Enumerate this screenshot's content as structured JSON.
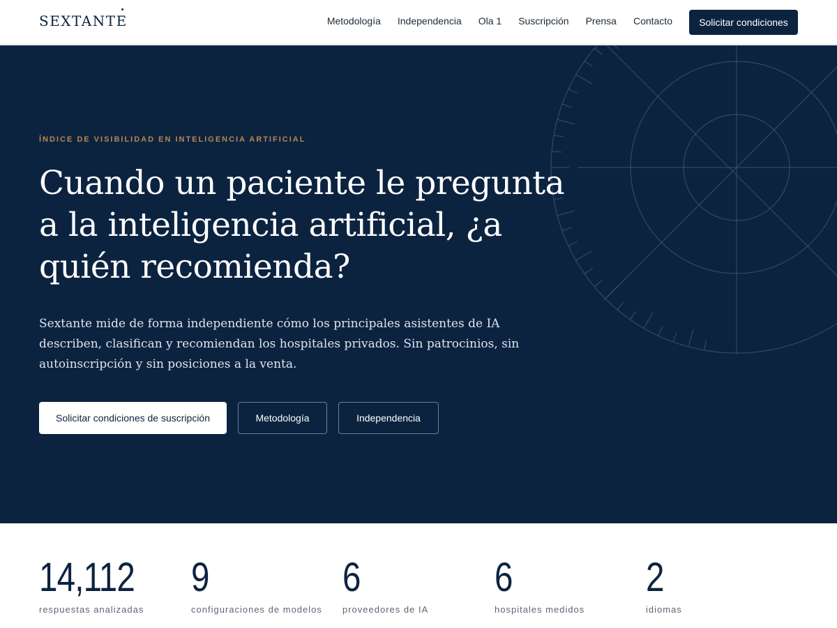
{
  "brand": {
    "name": "SEXTANTE"
  },
  "nav": {
    "items": [
      "Metodología",
      "Independencia",
      "Ola 1",
      "Suscripción",
      "Prensa",
      "Contacto"
    ],
    "cta_label": "Solicitar condiciones"
  },
  "hero": {
    "eyebrow": "ÍNDICE DE VISIBILIDAD EN INTELIGENCIA ARTIFICIAL",
    "headline": "Cuando un paciente le pregunta a la inteligencia artificial, ¿a quién recomienda?",
    "lede": "Sextante mide de forma independiente cómo los principales asistentes de IA describen, clasifican y recomiendan los hospitales privados. Sin patrocinios, sin autoinscripción y sin posiciones a la venta.",
    "buttons": {
      "primary": "Solicitar condiciones de suscripción",
      "methodology": "Metodología",
      "independence": "Independencia"
    }
  },
  "stats": [
    {
      "value": "14,112",
      "label": "respuestas analizadas"
    },
    {
      "value": "9",
      "label": "configuraciones de modelos"
    },
    {
      "value": "6",
      "label": "proveedores de IA"
    },
    {
      "value": "6",
      "label": "hospitales medidos"
    },
    {
      "value": "2",
      "label": "idiomas"
    }
  ],
  "colors": {
    "navy": "#0c2340",
    "accent_gold": "#b58a4c",
    "white": "#ffffff"
  },
  "icons": {
    "decoration": "sextant-compass-graphic"
  }
}
